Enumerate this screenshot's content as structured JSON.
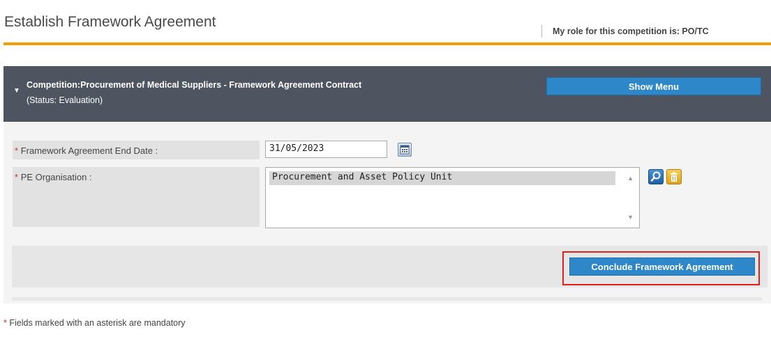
{
  "header": {
    "title": "Establish Framework Agreement",
    "role_text": "My role for this competition is: PO/TC"
  },
  "competition": {
    "title": "Competition:Procurement of Medical Suppliers - Framework Agreement Contract",
    "status": "(Status: Evaluation)",
    "show_menu_label": "Show Menu"
  },
  "form": {
    "end_date_label": "Framework Agreement End Date :",
    "end_date_value": "31/05/2023",
    "pe_org_label": "PE Organisation :",
    "pe_org_items": [
      "Procurement and Asset Policy Unit"
    ],
    "required_marker": "*"
  },
  "actions": {
    "conclude_label": "Conclude Framework Agreement"
  },
  "footer": {
    "mandatory_note": "Fields marked with an asterisk are mandatory"
  },
  "icons": {
    "calendar": "calendar-icon",
    "lookup": "search-icon",
    "delete": "trash-icon",
    "collapse": "chevron-down-icon"
  },
  "colors": {
    "accent_orange": "#f0a000",
    "button_blue": "#2d87c8",
    "header_dark": "#4e5560",
    "highlight_red": "#e02020"
  }
}
